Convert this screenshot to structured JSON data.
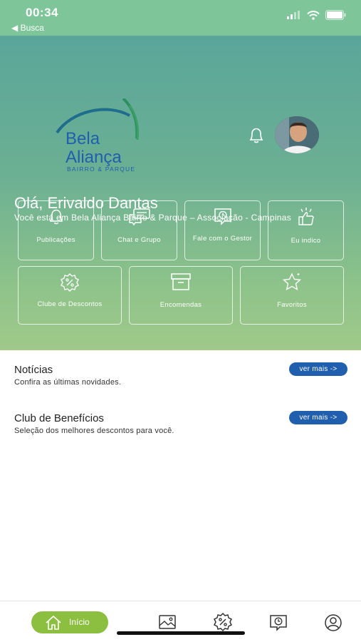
{
  "status_bar": {
    "time": "00:34",
    "back_label": "◀ Busca"
  },
  "brand": {
    "line1": "Bela",
    "line2": "Aliança",
    "tagline": "BAIRRO & PARQUE"
  },
  "greeting": "Olá, Erivaldo Dantas",
  "location": "Você está em Bela Aliança Bairro & Parque – Associação - Campinas",
  "tiles": [
    {
      "label": "Publicações",
      "icon": "bell-icon"
    },
    {
      "label": "Chat e Grupo",
      "icon": "chat-icon"
    },
    {
      "label": "Fale com o Gestor",
      "icon": "clock-message-icon"
    },
    {
      "label": "Eu indico",
      "icon": "thumbs-up-icon"
    },
    {
      "label": "Clube de Descontos",
      "icon": "discount-badge-icon"
    },
    {
      "label": "Encomendas",
      "icon": "package-box-icon"
    },
    {
      "label": "Favoritos",
      "icon": "star-icon"
    }
  ],
  "sections": [
    {
      "title": "Notícias",
      "subtitle": "Confira as últimas novidades.",
      "button": "ver mais ->"
    },
    {
      "title": "Club de Benefícios",
      "subtitle": "Seleção dos melhores descontos para você.",
      "button": "ver mais ->"
    }
  ],
  "bottom_nav": {
    "home_label": "Início"
  },
  "colors": {
    "status_bar": "#7ec69a",
    "hero_top": "#5aa69a",
    "hero_bottom": "#a0c98a",
    "brand_blue": "#1f5fae",
    "nav_active": "#8cbf3f"
  }
}
